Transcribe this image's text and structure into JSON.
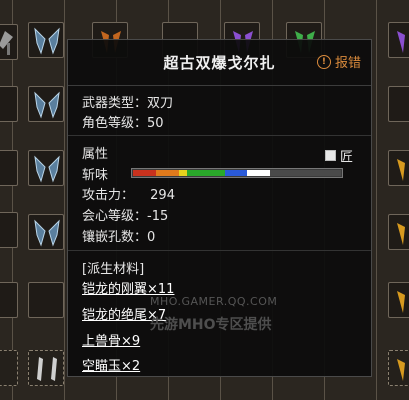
{
  "tooltip": {
    "title": "超古双爆戈尔扎",
    "report_label": "报错",
    "report_icon": "info-circle-icon",
    "weapon_type_label": "武器类型：",
    "weapon_type_value": "双刀",
    "char_level_label": "角色等级：",
    "char_level_value": "50",
    "attribute_heading": "属性",
    "craft_label": "匠",
    "sharpness_label": "斩味",
    "sharpness_segments": [
      {
        "color": "#c8321e",
        "fraction": 0.11
      },
      {
        "color": "#e07a1c",
        "fraction": 0.11
      },
      {
        "color": "#e6d21e",
        "fraction": 0.04
      },
      {
        "color": "#2aa82a",
        "fraction": 0.18
      },
      {
        "color": "#2a5ad8",
        "fraction": 0.11
      },
      {
        "color": "#ffffff",
        "fraction": 0.11
      },
      {
        "color": "#4a4a4a",
        "fraction": 0.34
      }
    ],
    "attack_label": "攻击力：",
    "attack_value": "294",
    "crit_label": "会心等级：",
    "crit_value": "-15",
    "slots_label": "镶嵌孔数：",
    "slots_value": "0",
    "materials_heading": "[派生材料]",
    "materials": [
      "铠龙的刚翼×11",
      "铠龙的绝尾×7",
      "上兽骨×9",
      "空瞄玉×2"
    ]
  },
  "watermark": {
    "line1": "MHO.GAMER.QQ.COM",
    "line2": "先游MHO专区提供"
  },
  "colors": {
    "tooltip_bg": "#0c0c0c",
    "report_accent": "#d98a3c",
    "grid_bg": "#2b2620"
  }
}
